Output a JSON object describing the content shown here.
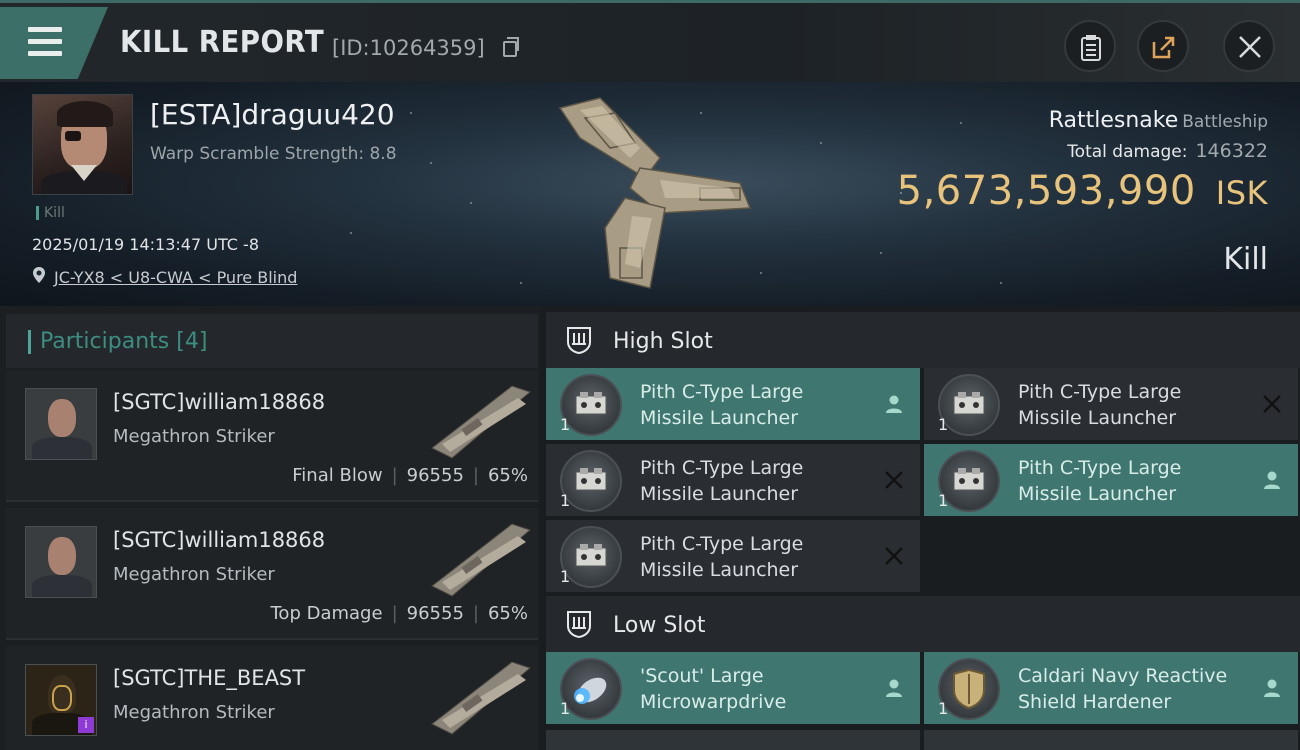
{
  "header": {
    "title": "KILL REPORT",
    "report_id": "[ID:10264359]",
    "menu_icon": "hamburger-icon",
    "clipboard_icon": "clipboard-icon",
    "share_icon": "share-icon",
    "close_icon": "close-icon"
  },
  "victim": {
    "name": "[ESTA]draguu420",
    "warp_scramble": "Warp Scramble Strength: 8.8",
    "tag": "Kill",
    "datetime": "2025/01/19 14:13:47 UTC -8",
    "location": "JC-YX8 < U8-CWA < Pure Blind",
    "ship_name": "Rattlesnake",
    "ship_class": "Battleship",
    "total_damage_label": "Total damage:",
    "total_damage_value": "146322",
    "isk_value": "5,673,593,990",
    "isk_unit": "ISK",
    "result": "Kill"
  },
  "participants": {
    "title": "Participants",
    "count": "[4]",
    "list": [
      {
        "name": "[SGTC]william18868",
        "ship": "Megathron Striker",
        "role": "Final Blow",
        "damage": "96555",
        "percent": "65%"
      },
      {
        "name": "[SGTC]william18868",
        "ship": "Megathron Striker",
        "role": "Top Damage",
        "damage": "96555",
        "percent": "65%"
      },
      {
        "name": "[SGTC]THE_BEAST",
        "ship": "Megathron Striker",
        "role": "",
        "damage": "",
        "percent": ""
      }
    ]
  },
  "fitting": {
    "high_slot": {
      "title": "High Slot",
      "modules": [
        {
          "line1": "Pith C-Type Large",
          "line2": "Missile Launcher",
          "qty": "1",
          "status": "fitted"
        },
        {
          "line1": "Pith C-Type Large",
          "line2": "Missile Launcher",
          "qty": "1",
          "status": "destroyed"
        },
        {
          "line1": "Pith C-Type Large",
          "line2": "Missile Launcher",
          "qty": "1",
          "status": "destroyed"
        },
        {
          "line1": "Pith C-Type Large",
          "line2": "Missile Launcher",
          "qty": "1",
          "status": "fitted"
        },
        {
          "line1": "Pith C-Type Large",
          "line2": "Missile Launcher",
          "qty": "1",
          "status": "destroyed"
        }
      ]
    },
    "low_slot": {
      "title": "Low Slot",
      "modules": [
        {
          "line1": "'Scout' Large",
          "line2": "Microwarpdrive",
          "qty": "1",
          "status": "fitted"
        },
        {
          "line1": "Caldari Navy Reactive",
          "line2": "Shield Hardener",
          "qty": "1",
          "status": "fitted"
        }
      ]
    }
  },
  "colors": {
    "accent_teal": "#3f7770",
    "isk_gold": "#e7c37c",
    "participants_teal": "#3d8d81"
  }
}
